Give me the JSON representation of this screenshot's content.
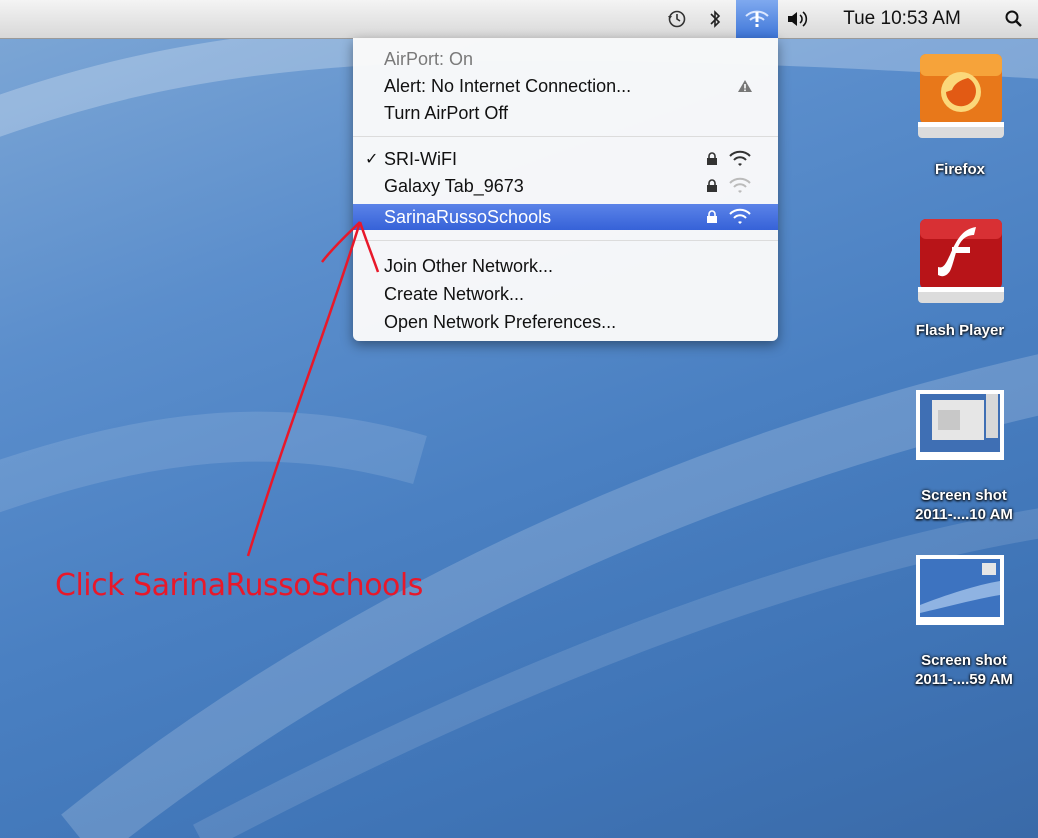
{
  "menubar": {
    "clock": "Tue 10:53 AM",
    "icons": [
      "time-machine-icon",
      "bluetooth-icon",
      "airport-status-icon",
      "volume-icon",
      "spotlight-icon"
    ]
  },
  "airport_menu": {
    "status": "AirPort: On",
    "alert": "Alert: No Internet Connection...",
    "toggle": "Turn AirPort Off",
    "networks": [
      {
        "name": "SRI-WiFI",
        "checked": true,
        "locked": true
      },
      {
        "name": "Galaxy Tab_9673",
        "checked": false,
        "locked": true
      },
      {
        "name": "SarinaRussoSchools",
        "checked": false,
        "locked": true,
        "highlighted": true
      }
    ],
    "join_other": "Join Other Network...",
    "create_network": "Create Network...",
    "open_prefs": "Open Network Preferences..."
  },
  "desktop_icons": [
    {
      "label_lines": [
        "Firefox"
      ],
      "icon": "firefox-drive-icon"
    },
    {
      "label_lines": [
        "Flash Player"
      ],
      "icon": "flash-player-drive-icon"
    },
    {
      "label_lines": [
        "Screen shot",
        "2011-....10 AM"
      ],
      "icon": "screenshot-thumbnail-icon"
    },
    {
      "label_lines": [
        "Screen shot",
        "2011-....59 AM"
      ],
      "icon": "screenshot-thumbnail-icon"
    }
  ],
  "annotation": {
    "text": "Click SarinaRussoSchools",
    "color": "#e8182a"
  },
  "colors": {
    "menu_highlight": "#3e6bdc",
    "desktop": "#4a80c2"
  }
}
